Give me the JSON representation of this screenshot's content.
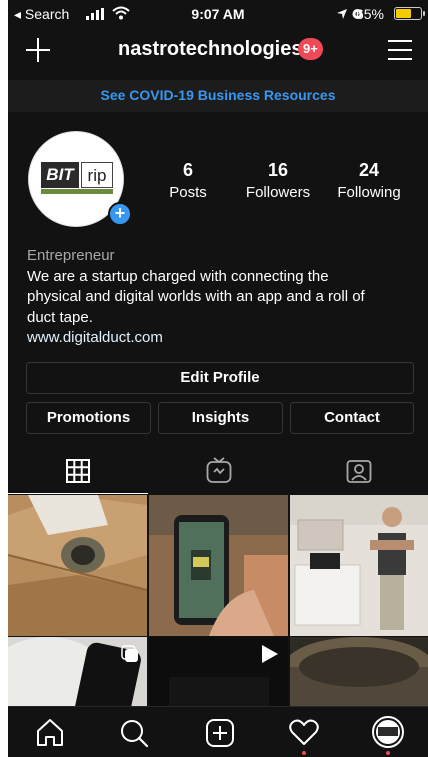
{
  "status_bar": {
    "back_app": "◂ Search",
    "time": "9:07 AM",
    "battery_percent": "65%",
    "battery_level": 0.65
  },
  "header": {
    "username": "nastrotechnologies",
    "notification_count": "9+"
  },
  "banner": {
    "text": "See COVID-19 Business Resources"
  },
  "profile": {
    "stats": [
      {
        "value": "6",
        "label": "Posts"
      },
      {
        "value": "16",
        "label": "Followers"
      },
      {
        "value": "24",
        "label": "Following"
      }
    ],
    "category": "Entrepreneur",
    "bio_lines": [
      "We are a startup charged with connecting the",
      "physical and digital worlds with an app and a roll of",
      "duct tape."
    ],
    "website": "www.digitalduct.com",
    "logo": {
      "brand_left": "BIT",
      "brand_right": "rip"
    }
  },
  "buttons": {
    "edit_profile": "Edit Profile",
    "promotions": "Promotions",
    "insights": "Insights",
    "contact": "Contact"
  },
  "tabs": [
    {
      "icon": "grid-icon",
      "active": true
    },
    {
      "icon": "igtv-icon",
      "active": false
    },
    {
      "icon": "tagged-icon",
      "active": false
    }
  ],
  "posts": [
    {
      "description": "cardboard box with duct tape roll"
    },
    {
      "description": "phone showing app in hand"
    },
    {
      "description": "man standing in room"
    },
    {
      "description": "phone on white surface"
    },
    {
      "description": "dark video post"
    },
    {
      "description": "duct tape roll close-up"
    }
  ],
  "bottom_nav": [
    "home-icon",
    "search-icon",
    "new-post-icon",
    "activity-icon",
    "profile-icon"
  ],
  "colors": {
    "background": "#121212",
    "link_blue": "#3897f0",
    "badge_red": "#ed4956",
    "battery_yellow": "#f5cc00"
  }
}
